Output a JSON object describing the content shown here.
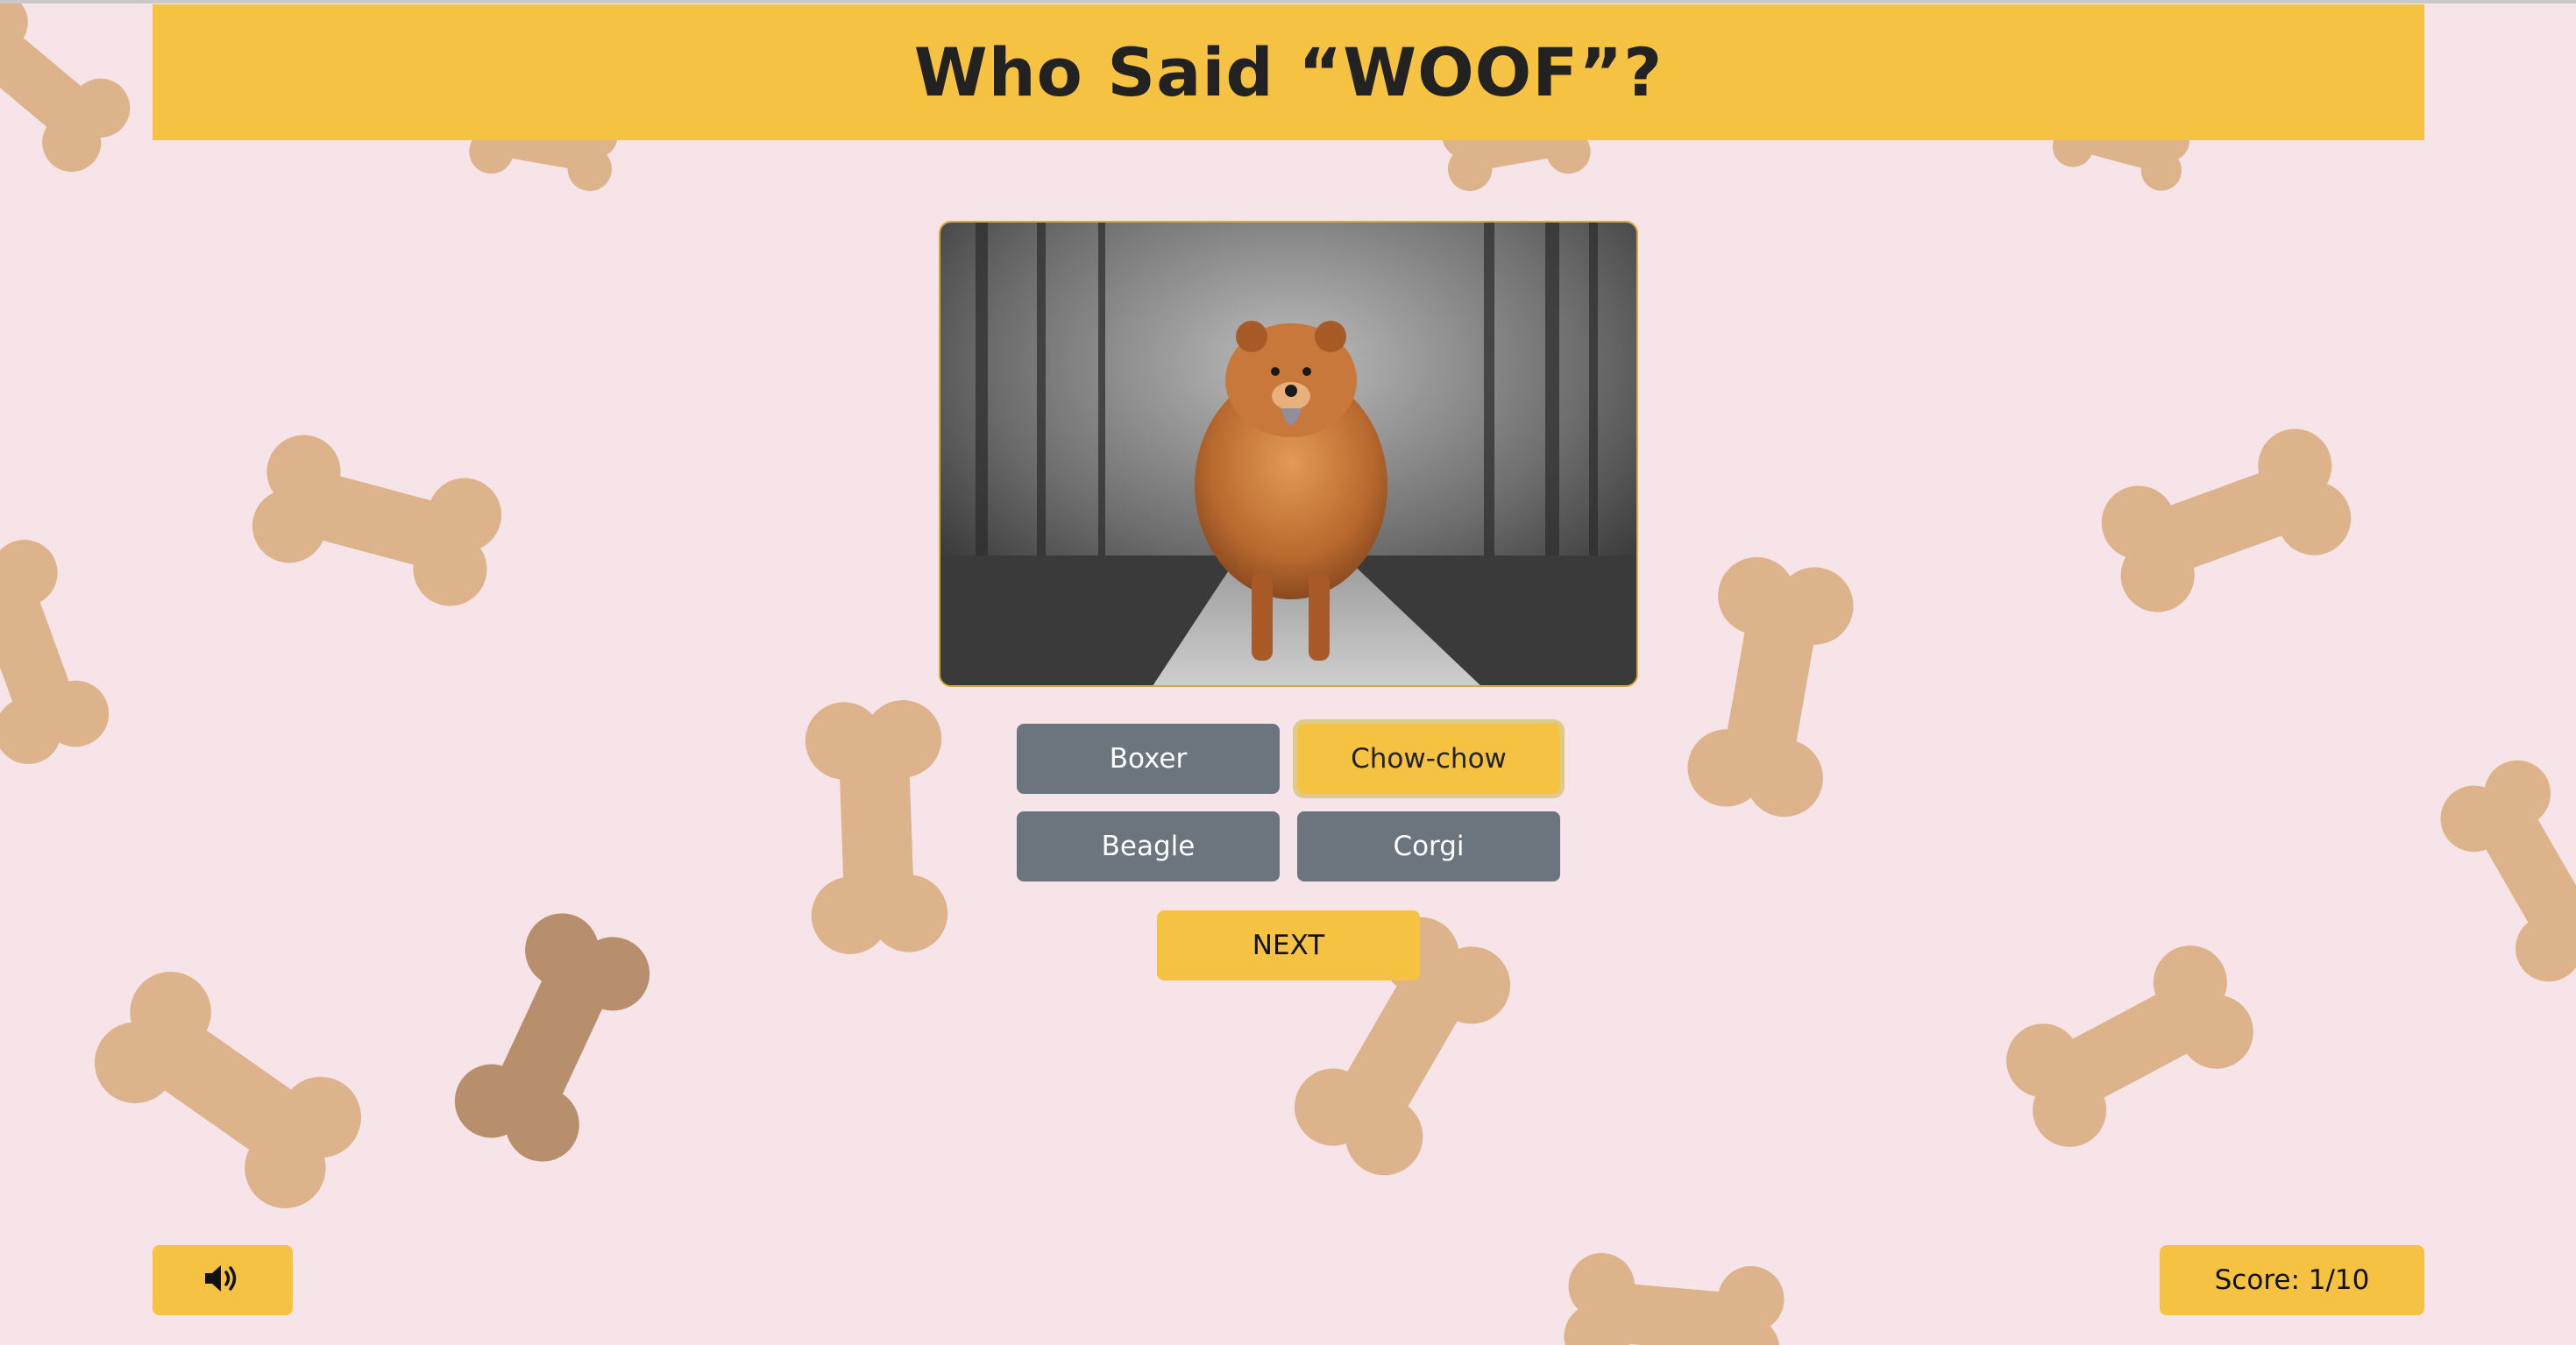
{
  "header": {
    "title": "Who Said “WOOF”?"
  },
  "quiz": {
    "image_subject": "chow-chow dog walking on a forest path",
    "answers": [
      {
        "label": "Boxer",
        "selected": false
      },
      {
        "label": "Chow-chow",
        "selected": true
      },
      {
        "label": "Beagle",
        "selected": false
      },
      {
        "label": "Corgi",
        "selected": false
      }
    ],
    "next_label": "NEXT"
  },
  "footer": {
    "sound_icon": "speaker-volume-icon",
    "score_text": "Score: 1/10"
  },
  "colors": {
    "accent": "#f5c242",
    "button_gray": "#6c757d",
    "background": "#f7e4e9"
  }
}
